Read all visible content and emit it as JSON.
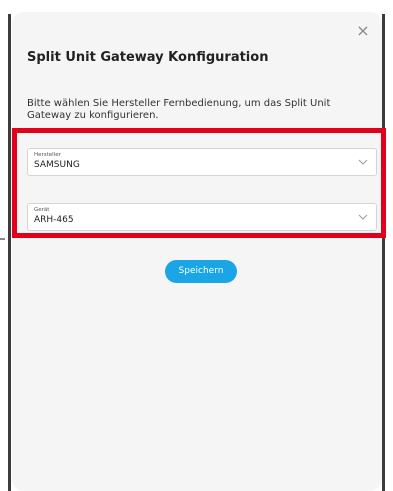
{
  "dialog": {
    "close_glyph": "×",
    "title": "Split Unit Gateway Konfiguration",
    "intro": "Bitte wählen Sie Hersteller Fernbedienung, um das Split Unit Gateway zu konfigurieren."
  },
  "manufacturer": {
    "label": "Hersteller",
    "value": "SAMSUNG",
    "icon": "chevron-down-icon"
  },
  "device": {
    "label": "Gerät",
    "value": "ARH-465",
    "icon": "chevron-down-icon"
  },
  "actions": {
    "save_label": "Speichern"
  },
  "colors": {
    "highlight": "#e3001b",
    "accent": "#1aa6e6",
    "modal_bg": "#f5f5f5"
  }
}
